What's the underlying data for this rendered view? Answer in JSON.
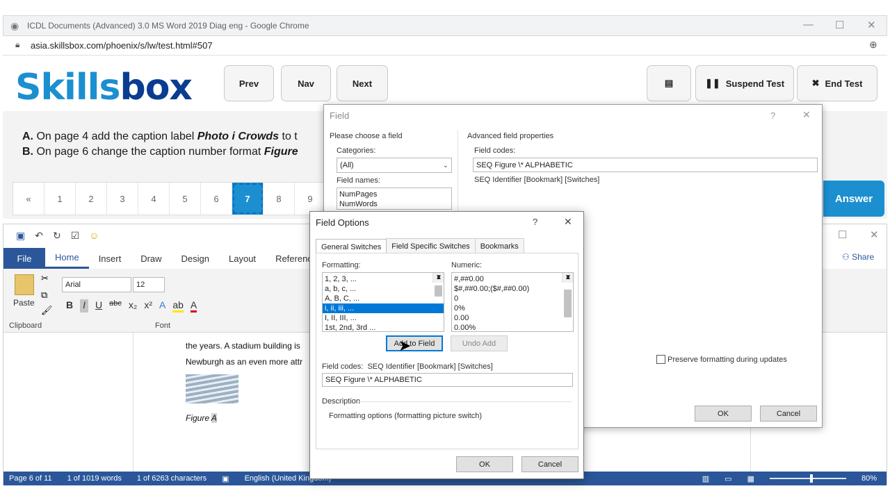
{
  "browser": {
    "title": "ICDL Documents (Advanced) 3.0 MS Word 2019 Diag eng - Google Chrome",
    "url": "asia.skillsbox.com/phoenix/s/lw/test.html#507"
  },
  "skillsbox": {
    "logo_a": "Skills",
    "logo_b": "box",
    "prev": "Prev",
    "nav": "Nav",
    "next": "Next",
    "suspend": "Suspend Test",
    "end": "End Test",
    "answer": "Answer"
  },
  "task": {
    "a_prefix": "A.",
    "a_text": " On page 4 add the caption label ",
    "a_emph": "Photo i Crowds",
    "a_tail": " to t",
    "b_prefix": "B.",
    "b_text": " On page 6 change the caption number format ",
    "b_emph": "Figure"
  },
  "pager": [
    "«",
    "1",
    "2",
    "3",
    "4",
    "5",
    "6",
    "7",
    "8",
    "9"
  ],
  "word": {
    "tabs": [
      "File",
      "Home",
      "Insert",
      "Draw",
      "Design",
      "Layout",
      "References"
    ],
    "share": "Share",
    "font_name": "Arial",
    "font_size": "12",
    "clipboard": "Clipboard",
    "font": "Font",
    "paste": "Paste",
    "doc_line1": "the years. A stadium building is",
    "doc_line2": "Newburgh as an even more attr",
    "caption": "Figure ",
    "caption_field": "A",
    "status": {
      "page": "Page 6 of 11",
      "words": "1 of 1019 words",
      "chars": "1 of 6263 characters",
      "lang": "English (United Kingdom)",
      "zoom": "80%"
    }
  },
  "field_dialog": {
    "title": "Field",
    "choose": "Please choose a field",
    "categories_label": "Categories:",
    "categories_value": "(All)",
    "field_names_label": "Field names:",
    "field_names": [
      "NumPages",
      "NumWords"
    ],
    "advanced": "Advanced field properties",
    "field_codes_label": "Field codes:",
    "field_codes_value": "SEQ Figure \\* ALPHABETIC",
    "syntax": "SEQ Identifier [Bookmark] [Switches]",
    "preserve": "Preserve formatting during updates",
    "ok": "OK",
    "cancel": "Cancel"
  },
  "field_options": {
    "title": "Field Options",
    "help": "?",
    "tabs": [
      "General Switches",
      "Field Specific Switches",
      "Bookmarks"
    ],
    "formatting_label": "Formatting:",
    "formatting": [
      "1, 2, 3, ...",
      "a, b, c, ...",
      "A, B, C, ...",
      "i, ii, iii, ...",
      "I, II, III, ...",
      "1st, 2nd, 3rd ..."
    ],
    "numeric_label": "Numeric:",
    "numeric": [
      "#,##0.00",
      "$#,##0.00;($#,##0.00)",
      "0",
      "0%",
      "0.00",
      "0.00%"
    ],
    "add_to_field": "Add to Field",
    "undo_add": "Undo Add",
    "field_codes_label": "Field codes:",
    "field_codes_syntax": "SEQ Identifier [Bookmark] [Switches]",
    "field_codes_value": "SEQ Figure \\* ALPHABETIC",
    "description_label": "Description",
    "description": "Formatting options (formatting picture switch)",
    "ok": "OK",
    "cancel": "Cancel"
  }
}
